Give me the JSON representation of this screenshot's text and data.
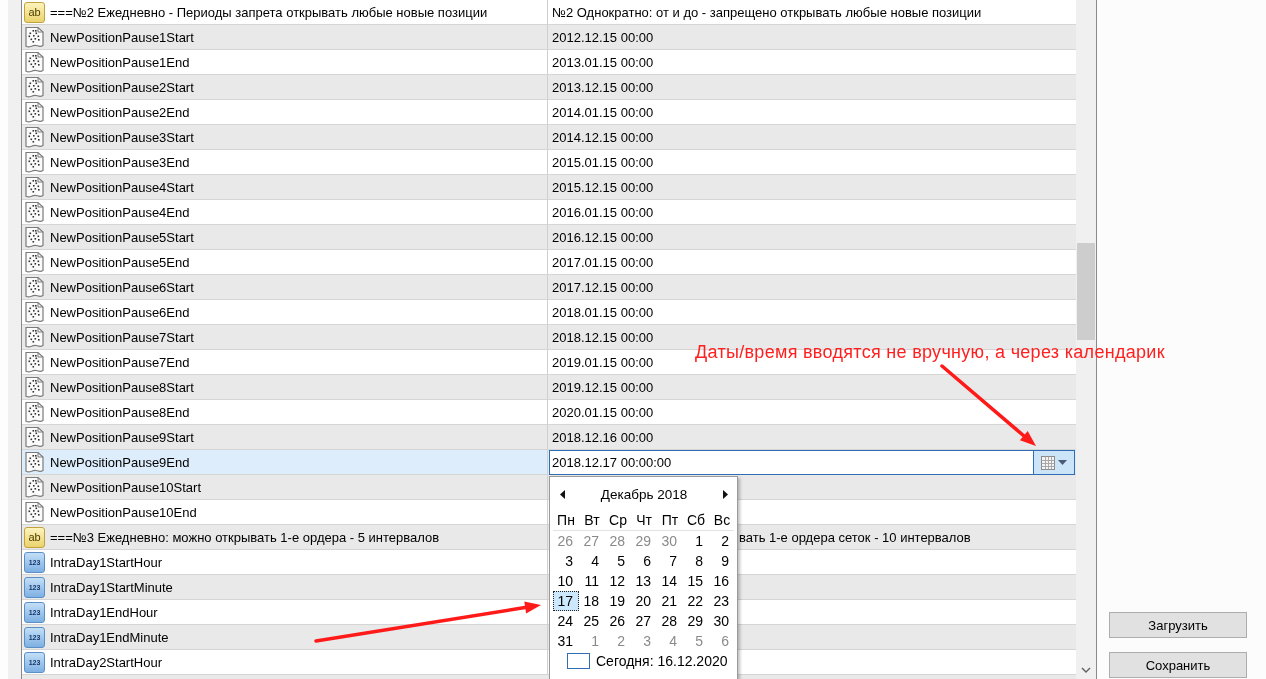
{
  "table": {
    "rows": [
      {
        "kind": "group",
        "icon_label": "ab",
        "name": "===№2 Ежедневно - Периоды запрета открывать любые новые позиции",
        "value": "№2 Однократно: от и до - запрещено открывать любые новые позиции",
        "selected": false,
        "editing": false
      },
      {
        "kind": "datetime",
        "name": "NewPositionPause1Start",
        "value": "2012.12.15 00:00",
        "selected": false,
        "editing": false
      },
      {
        "kind": "datetime",
        "name": "NewPositionPause1End",
        "value": "2013.01.15 00:00",
        "selected": false,
        "editing": false
      },
      {
        "kind": "datetime",
        "name": "NewPositionPause2Start",
        "value": "2013.12.15 00:00",
        "selected": false,
        "editing": false
      },
      {
        "kind": "datetime",
        "name": "NewPositionPause2End",
        "value": "2014.01.15 00:00",
        "selected": false,
        "editing": false
      },
      {
        "kind": "datetime",
        "name": "NewPositionPause3Start",
        "value": "2014.12.15 00:00",
        "selected": false,
        "editing": false
      },
      {
        "kind": "datetime",
        "name": "NewPositionPause3End",
        "value": "2015.01.15 00:00",
        "selected": false,
        "editing": false
      },
      {
        "kind": "datetime",
        "name": "NewPositionPause4Start",
        "value": "2015.12.15 00:00",
        "selected": false,
        "editing": false
      },
      {
        "kind": "datetime",
        "name": "NewPositionPause4End",
        "value": "2016.01.15 00:00",
        "selected": false,
        "editing": false
      },
      {
        "kind": "datetime",
        "name": "NewPositionPause5Start",
        "value": "2016.12.15 00:00",
        "selected": false,
        "editing": false
      },
      {
        "kind": "datetime",
        "name": "NewPositionPause5End",
        "value": "2017.01.15 00:00",
        "selected": false,
        "editing": false
      },
      {
        "kind": "datetime",
        "name": "NewPositionPause6Start",
        "value": "2017.12.15 00:00",
        "selected": false,
        "editing": false
      },
      {
        "kind": "datetime",
        "name": "NewPositionPause6End",
        "value": "2018.01.15 00:00",
        "selected": false,
        "editing": false
      },
      {
        "kind": "datetime",
        "name": "NewPositionPause7Start",
        "value": "2018.12.15 00:00",
        "selected": false,
        "editing": false
      },
      {
        "kind": "datetime",
        "name": "NewPositionPause7End",
        "value": "2019.01.15 00:00",
        "selected": false,
        "editing": false
      },
      {
        "kind": "datetime",
        "name": "NewPositionPause8Start",
        "value": "2019.12.15 00:00",
        "selected": false,
        "editing": false
      },
      {
        "kind": "datetime",
        "name": "NewPositionPause8End",
        "value": "2020.01.15 00:00",
        "selected": false,
        "editing": false
      },
      {
        "kind": "datetime",
        "name": "NewPositionPause9Start",
        "value": "2018.12.16 00:00",
        "selected": false,
        "editing": false
      },
      {
        "kind": "datetime",
        "name": "NewPositionPause9End",
        "value": "2018.12.17 00:00:00",
        "selected": true,
        "editing": true
      },
      {
        "kind": "datetime",
        "name": "NewPositionPause10Start",
        "selected": false,
        "editing": false
      },
      {
        "kind": "datetime",
        "name": "NewPositionPause10End",
        "selected": false,
        "editing": false
      },
      {
        "kind": "group",
        "icon_label": "ab",
        "name": "===№3 Ежедневно: можно открывать 1-е ордера - 5 интервалов",
        "value": "вать 1-е ордера сеток - 10 интервалов",
        "selected": false,
        "editing": false
      },
      {
        "kind": "int",
        "icon_label": "123",
        "name": "IntraDay1StartHour",
        "selected": false,
        "editing": false
      },
      {
        "kind": "int",
        "icon_label": "123",
        "name": "IntraDay1StartMinute",
        "selected": false,
        "editing": false
      },
      {
        "kind": "int",
        "icon_label": "123",
        "name": "IntraDay1EndHour",
        "selected": false,
        "editing": false
      },
      {
        "kind": "int",
        "icon_label": "123",
        "name": "IntraDay1EndMinute",
        "selected": false,
        "editing": false
      },
      {
        "kind": "int",
        "icon_label": "123",
        "name": "IntraDay2StartHour",
        "selected": false,
        "editing": false
      }
    ]
  },
  "calendar": {
    "month_label": "Декабрь 2018",
    "weekdays": [
      "Пн",
      "Вт",
      "Ср",
      "Чт",
      "Пт",
      "Сб",
      "Вс"
    ],
    "weeks": [
      [
        {
          "day": "26",
          "other_month": true,
          "selected": false
        },
        {
          "day": "27",
          "other_month": true,
          "selected": false
        },
        {
          "day": "28",
          "other_month": true,
          "selected": false
        },
        {
          "day": "29",
          "other_month": true,
          "selected": false
        },
        {
          "day": "30",
          "other_month": true,
          "selected": false
        },
        {
          "day": "1",
          "other_month": false,
          "selected": false
        },
        {
          "day": "2",
          "other_month": false,
          "selected": false
        }
      ],
      [
        {
          "day": "3",
          "other_month": false,
          "selected": false
        },
        {
          "day": "4",
          "other_month": false,
          "selected": false
        },
        {
          "day": "5",
          "other_month": false,
          "selected": false
        },
        {
          "day": "6",
          "other_month": false,
          "selected": false
        },
        {
          "day": "7",
          "other_month": false,
          "selected": false
        },
        {
          "day": "8",
          "other_month": false,
          "selected": false
        },
        {
          "day": "9",
          "other_month": false,
          "selected": false
        }
      ],
      [
        {
          "day": "10",
          "other_month": false,
          "selected": false
        },
        {
          "day": "11",
          "other_month": false,
          "selected": false
        },
        {
          "day": "12",
          "other_month": false,
          "selected": false
        },
        {
          "day": "13",
          "other_month": false,
          "selected": false
        },
        {
          "day": "14",
          "other_month": false,
          "selected": false
        },
        {
          "day": "15",
          "other_month": false,
          "selected": false
        },
        {
          "day": "16",
          "other_month": false,
          "selected": false
        }
      ],
      [
        {
          "day": "17",
          "other_month": false,
          "selected": true
        },
        {
          "day": "18",
          "other_month": false,
          "selected": false
        },
        {
          "day": "19",
          "other_month": false,
          "selected": false
        },
        {
          "day": "20",
          "other_month": false,
          "selected": false
        },
        {
          "day": "21",
          "other_month": false,
          "selected": false
        },
        {
          "day": "22",
          "other_month": false,
          "selected": false
        },
        {
          "day": "23",
          "other_month": false,
          "selected": false
        }
      ],
      [
        {
          "day": "24",
          "other_month": false,
          "selected": false
        },
        {
          "day": "25",
          "other_month": false,
          "selected": false
        },
        {
          "day": "26",
          "other_month": false,
          "selected": false
        },
        {
          "day": "27",
          "other_month": false,
          "selected": false
        },
        {
          "day": "28",
          "other_month": false,
          "selected": false
        },
        {
          "day": "29",
          "other_month": false,
          "selected": false
        },
        {
          "day": "30",
          "other_month": false,
          "selected": false
        }
      ],
      [
        {
          "day": "31",
          "other_month": false,
          "selected": false
        },
        {
          "day": "1",
          "other_month": true,
          "selected": false
        },
        {
          "day": "2",
          "other_month": true,
          "selected": false
        },
        {
          "day": "3",
          "other_month": true,
          "selected": false
        },
        {
          "day": "4",
          "other_month": true,
          "selected": false
        },
        {
          "day": "5",
          "other_month": true,
          "selected": false
        },
        {
          "day": "6",
          "other_month": true,
          "selected": false
        }
      ]
    ],
    "today_label": "Сегодня: 16.12.2020"
  },
  "annotation": {
    "text": "Даты/время вводятся не вручную, а через календарик"
  },
  "buttons": [
    "Загрузить",
    "Сохранить"
  ]
}
